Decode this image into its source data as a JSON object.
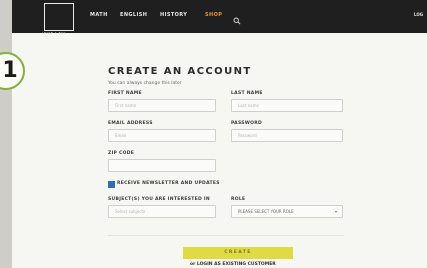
{
  "nav": {
    "logo_text": "LEARN & BUY",
    "items": [
      "MATH",
      "ENGLISH",
      "HISTORY",
      "SHOP"
    ],
    "active": "SHOP",
    "search_icon": "search-icon",
    "login": "LOG"
  },
  "form": {
    "heading": "CREATE AN ACCOUNT",
    "subtext": "You can always change this later",
    "first_name": {
      "label": "FIRST NAME",
      "placeholder": "First name"
    },
    "last_name": {
      "label": "LAST NAME",
      "placeholder": "Last name"
    },
    "email": {
      "label": "EMAIL ADDRESS",
      "placeholder": "Email"
    },
    "password": {
      "label": "PASSWORD",
      "placeholder": "Password"
    },
    "zip": {
      "label": "ZIP CODE",
      "placeholder": ""
    },
    "newsletter": {
      "label": "RECEIVE NEWSLETTER AND UPDATES",
      "checked": true
    },
    "subjects": {
      "label": "SUBJECT(S) YOU ARE INTERESTED IN",
      "placeholder": "Select subjects"
    },
    "role": {
      "label": "ROLE",
      "value": "PLEASE SELECT YOUR ROLE"
    },
    "create_label": "CREATE",
    "login_link": "or LOGIN AS EXISTING CUSTOMER"
  },
  "callout": {
    "number": "1"
  },
  "colors": {
    "nav_bg": "#1f1f1f",
    "shop_accent": "#f08f2f",
    "button": "#e0da45",
    "checkbox": "#2f6fb4",
    "callout_ring": "#7fb13b"
  }
}
